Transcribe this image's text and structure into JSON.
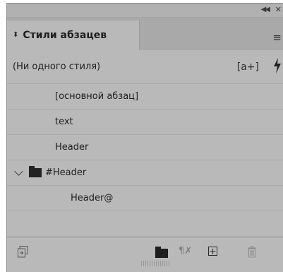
{
  "window": {
    "collapse_icon": "double-chevron-left",
    "close_icon": "close"
  },
  "tab": {
    "label": "Стили абзацев",
    "icon": "up-down-arrows"
  },
  "header_row": {
    "current_style": "(Ни одного стиля)",
    "new_override_label": "[a+]",
    "quick_apply_icon": "lightning"
  },
  "styles": [
    {
      "label": "[основной абзац]"
    },
    {
      "label": "text"
    },
    {
      "label": "Header"
    },
    {
      "label": "#Header",
      "type": "group",
      "expanded": true
    },
    {
      "label": "Header@",
      "level": 2
    }
  ],
  "bottom_bar": {
    "clear_overrides_label": "¶✗",
    "new_style_label": "+"
  }
}
